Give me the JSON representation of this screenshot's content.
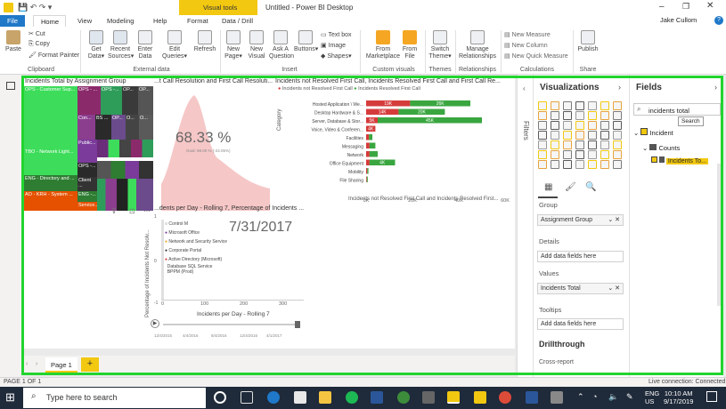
{
  "window": {
    "title": "Untitled - Power BI Desktop",
    "visual_tools": "Visual tools",
    "user": "Jake Cullom"
  },
  "tabs": [
    "File",
    "Home",
    "View",
    "Modeling",
    "Help",
    "Format",
    "Data / Drill"
  ],
  "ribbon": {
    "clipboard": {
      "paste": "Paste",
      "cut": "Cut",
      "copy": "Copy",
      "format_painter": "Format Painter",
      "group": "Clipboard"
    },
    "external_data": {
      "get_data": "Get Data",
      "recent_sources": "Recent Sources",
      "enter_data": "Enter Data",
      "edit_queries": "Edit Queries",
      "refresh": "Refresh",
      "group": "External data"
    },
    "insert": {
      "new_page": "New Page",
      "new_visual": "New Visual",
      "ask_question": "Ask A Question",
      "buttons": "Buttons",
      "text_box": "Text box",
      "image": "Image",
      "shapes": "Shapes",
      "group": "Insert"
    },
    "custom_visuals": {
      "from_marketplace": "From Marketplace",
      "from_file": "From File",
      "group": "Custom visuals"
    },
    "themes": {
      "switch_theme": "Switch Theme",
      "group": "Themes"
    },
    "relationships": {
      "manage": "Manage Relationships",
      "group": "Relationships"
    },
    "calculations": {
      "new_measure": "New Measure",
      "new_column": "New Column",
      "new_quick_measure": "New Quick Measure",
      "group": "Calculations"
    },
    "share": {
      "publish": "Publish",
      "group": "Share"
    }
  },
  "report": {
    "treemap": {
      "title": "Incidents Total by Assignment Group",
      "tiles": [
        "OPS - Customer Sup...",
        "OPS - ...",
        "OPS -...",
        "OP...",
        "OP...",
        "Con...",
        "BS ...",
        "OP...",
        "O...",
        "O...",
        "TBO - Network Light...",
        "Public...",
        "OPS -...",
        "ENG - Directory and ...",
        "Client ...",
        "AO - KRH - System ...",
        "ENG -...",
        "Service..."
      ]
    },
    "gauge": {
      "title": "...t Call Resolution and First Call Resoluti...",
      "value": "68.33 %",
      "goal": "Goal: 98.00 % (-24.05%)"
    },
    "bar": {
      "title": "Incidents not Resolved First Call, Incidents Resolved First Call and First Call Re...",
      "legend": [
        "Incidents not Resolved First Call",
        "Incidents Resolved First Call"
      ],
      "ylabel": "Category",
      "xlabel": "Incidents not Resolved First Call and Incidents Resolved First...",
      "xticks": [
        "0K",
        "20K",
        "40K",
        "60K"
      ]
    },
    "scatter": {
      "title": "...dents per Day - Rolling 7, Percentage of Incidents ...",
      "date": "7/31/2017",
      "ylabel": "Percentage of Incidents Not Resolv...",
      "xlabel": "Incidents per Day - Rolling 7",
      "xticks": [
        "0",
        "100",
        "200",
        "300"
      ],
      "yticks": [
        "1",
        "0",
        "-1"
      ],
      "points": [
        "Control M",
        "Microsoft Office",
        "Network and Security Service",
        "Corporate Portal",
        "Active Directory (Microsoft)",
        "Database SQL Service",
        "BPPM (Prod)"
      ],
      "play_dates": [
        "12/4/2015",
        "4/4/2016",
        "8/4/2016",
        "12/4/2016",
        "4/1/2017"
      ]
    },
    "page_tab": "Page 1"
  },
  "chart_data": {
    "type": "bar",
    "title": "Incidents not Resolved First Call, Incidents Resolved First Call and First Call Re...",
    "ylabel": "Category",
    "xlabel": "Incidents not Resolved First Call and Incidents Resolved First...",
    "xlim": [
      0,
      60000
    ],
    "categories": [
      "Hosted Application \\ We...",
      "Desktop Hardware & S...",
      "Server, Database & Stor...",
      "Voice, Video & Conferen...",
      "Facilities",
      "Messaging",
      "Network",
      "Office Equipment",
      "Mobility",
      "File Sharing"
    ],
    "series": [
      {
        "name": "Incidents not Resolved First Call",
        "color": "#d63b3b",
        "values": [
          19000,
          14000,
          5000,
          4000,
          1200,
          1500,
          1500,
          1500,
          500,
          300
        ],
        "labels": [
          "19K",
          "14K",
          "5K",
          "4K",
          "",
          "",
          "",
          "",
          "",
          ""
        ]
      },
      {
        "name": "Incidents Resolved First Call",
        "color": "#3aa640",
        "values": [
          26000,
          20000,
          45000,
          0,
          1500,
          2500,
          3500,
          11000,
          500,
          400
        ],
        "labels": [
          "26K",
          "20K",
          "45K",
          "",
          "",
          "",
          "",
          "4K",
          "",
          ""
        ]
      }
    ]
  },
  "visualizations": {
    "title": "Visualizations"
  },
  "fields": {
    "title": "Fields",
    "search": "incidents total",
    "search_tooltip": "Search",
    "table": "Incident",
    "folder": "Counts",
    "field": "Incidents To..."
  },
  "wells": {
    "group_label": "Group",
    "group_value": "Assignment Group",
    "details_label": "Details",
    "details_placeholder": "Add data fields here",
    "values_label": "Values",
    "values_value": "Incidents Total",
    "tooltips_label": "Tooltips",
    "tooltips_placeholder": "Add data fields here",
    "drillthrough": "Drillthrough",
    "cross_report": "Cross-report"
  },
  "filters_label": "Filters",
  "status": {
    "page": "PAGE 1 OF 1",
    "connection": "Live connection: Connected"
  },
  "taskbar": {
    "search": "Type here to search",
    "lang": "ENG",
    "region": "US",
    "time": "10:10 AM",
    "date": "9/17/2019"
  }
}
